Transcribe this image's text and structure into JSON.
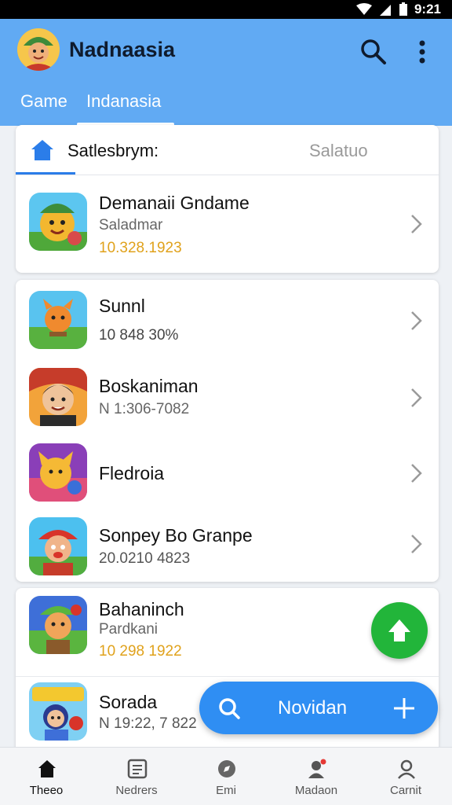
{
  "status_bar": {
    "time": "9:21"
  },
  "header": {
    "title": "Nadnaasia",
    "tabs": [
      {
        "label": "Game"
      },
      {
        "label": "Indanasia"
      }
    ]
  },
  "featured": {
    "subheader_title": "Satlesbrym:",
    "subheader_right": "Salatuo",
    "game": {
      "name": "Demanaii Gndame",
      "subtitle": "Saladmar",
      "count": "10.328.1923"
    }
  },
  "games": [
    {
      "name": "Sunnl",
      "count": "10 848 30%",
      "count_color": "#444444"
    },
    {
      "name": "Boskaniman",
      "count": "N 1:306-7082",
      "count_color": "#666666"
    },
    {
      "name": "Fledroia"
    },
    {
      "name": "Sonpey Bo Granpe",
      "count": "20.0210 4823",
      "count_color": "#555555"
    },
    {
      "name": "Bahaninch",
      "subtitle": "Pardkani",
      "count": "10 298 1922",
      "count_color": "#e0a21c"
    },
    {
      "name": "Sorada",
      "count": "N 19:22, 7 822",
      "count_color": "#555555"
    }
  ],
  "fab_pill": {
    "label": "Novidan"
  },
  "bottom_nav": [
    {
      "label": "Theeo",
      "icon": "home-icon"
    },
    {
      "label": "Nedrers",
      "icon": "news-icon"
    },
    {
      "label": "Emi",
      "icon": "compass-icon"
    },
    {
      "label": "Madaon",
      "icon": "person-badge-icon"
    },
    {
      "label": "Carnit",
      "icon": "profile-icon"
    }
  ],
  "colors": {
    "header_bg": "#61aaf3",
    "accent": "#2f8ef3",
    "count_highlight": "#e0a21c",
    "fab_green": "#22b53a"
  }
}
